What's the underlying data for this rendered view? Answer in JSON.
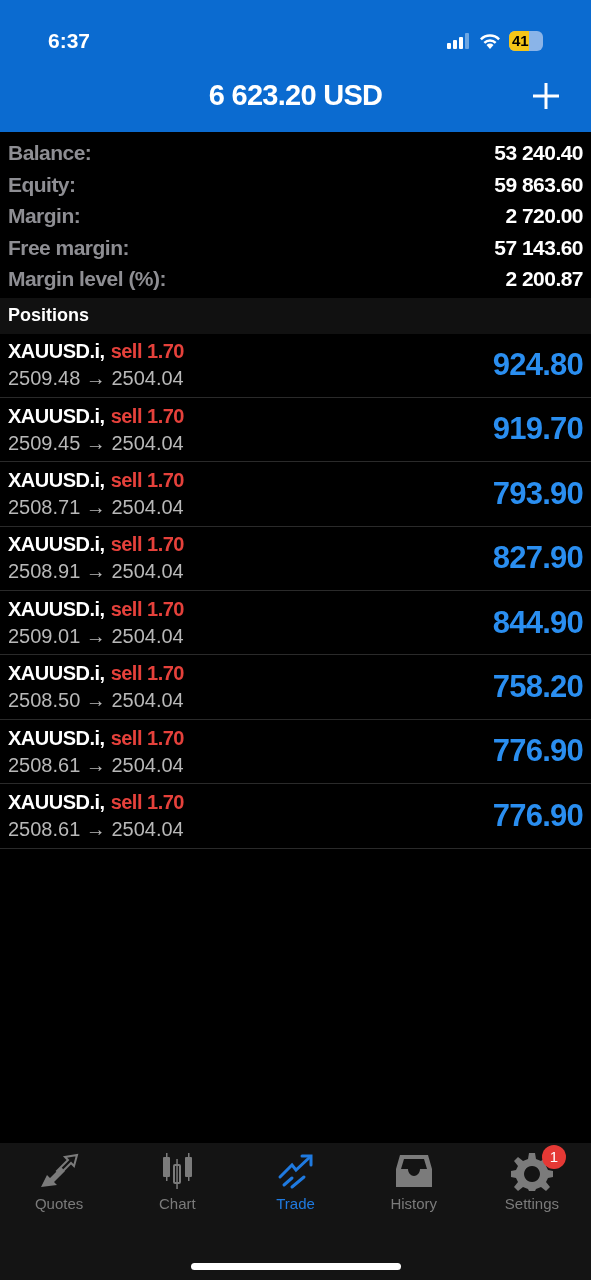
{
  "status_bar": {
    "time": "6:37",
    "battery": "41"
  },
  "header": {
    "title": "6 623.20 USD"
  },
  "summary": [
    {
      "label": "Balance:",
      "value": "53 240.40"
    },
    {
      "label": "Equity:",
      "value": "59 863.60"
    },
    {
      "label": "Margin:",
      "value": "2 720.00"
    },
    {
      "label": "Free margin:",
      "value": "57 143.60"
    },
    {
      "label": "Margin level (%):",
      "value": "2 200.87"
    }
  ],
  "positions_header": "Positions",
  "positions": [
    {
      "symbol": "XAUUSD.i,",
      "side": "sell 1.70",
      "prices": "2509.48 → 2504.04",
      "profit": "924.80"
    },
    {
      "symbol": "XAUUSD.i,",
      "side": "sell 1.70",
      "prices": "2509.45 → 2504.04",
      "profit": "919.70"
    },
    {
      "symbol": "XAUUSD.i,",
      "side": "sell 1.70",
      "prices": "2508.71 → 2504.04",
      "profit": "793.90"
    },
    {
      "symbol": "XAUUSD.i,",
      "side": "sell 1.70",
      "prices": "2508.91 → 2504.04",
      "profit": "827.90"
    },
    {
      "symbol": "XAUUSD.i,",
      "side": "sell 1.70",
      "prices": "2509.01 → 2504.04",
      "profit": "844.90"
    },
    {
      "symbol": "XAUUSD.i,",
      "side": "sell 1.70",
      "prices": "2508.50 → 2504.04",
      "profit": "758.20"
    },
    {
      "symbol": "XAUUSD.i,",
      "side": "sell 1.70",
      "prices": "2508.61 → 2504.04",
      "profit": "776.90"
    },
    {
      "symbol": "XAUUSD.i,",
      "side": "sell 1.70",
      "prices": "2508.61 → 2504.04",
      "profit": "776.90"
    }
  ],
  "tabs": [
    {
      "kind": "quotes",
      "label": "Quotes",
      "selected": false
    },
    {
      "kind": "chart",
      "label": "Chart",
      "selected": false
    },
    {
      "kind": "trade",
      "label": "Trade",
      "selected": true
    },
    {
      "kind": "history",
      "label": "History",
      "selected": false
    },
    {
      "kind": "settings",
      "label": "Settings",
      "selected": false,
      "badge": "1"
    }
  ]
}
